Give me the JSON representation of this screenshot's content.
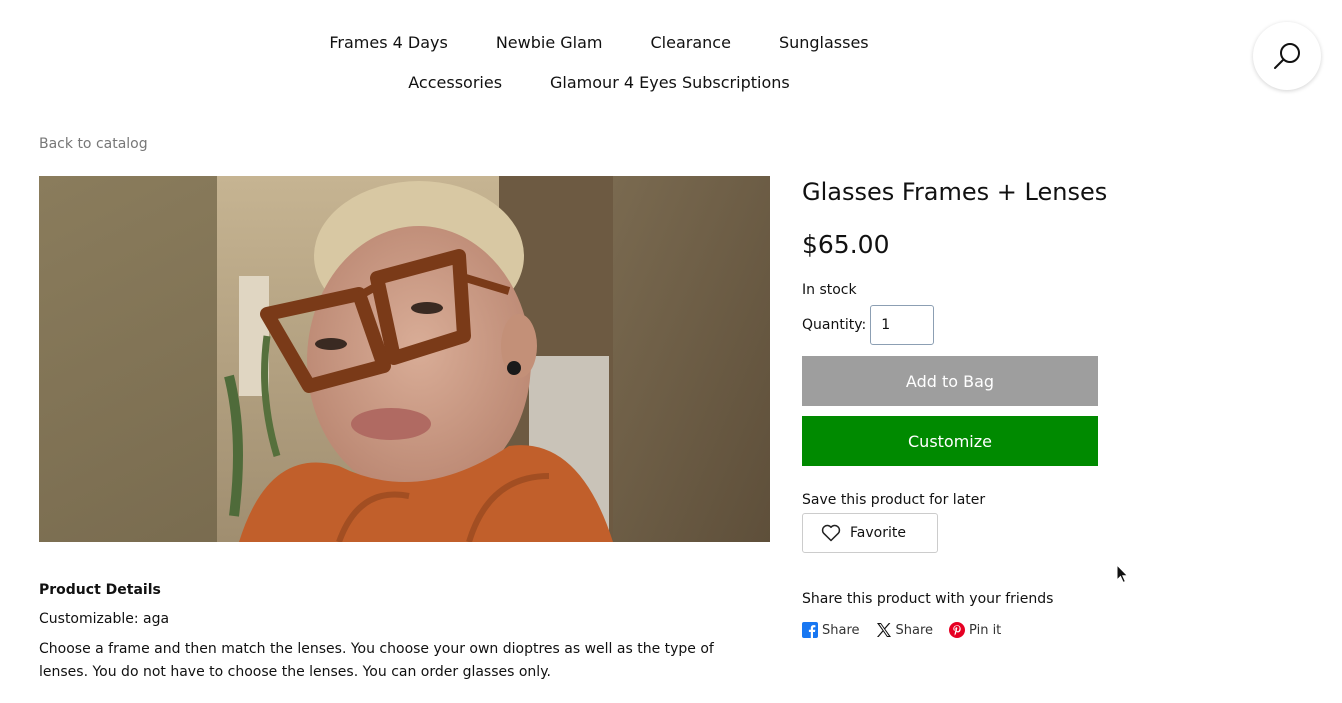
{
  "nav": {
    "row1": [
      "Frames 4 Days",
      "Newbie Glam",
      "Clearance",
      "Sunglasses"
    ],
    "row2": [
      "Accessories",
      "Glamour 4 Eyes Subscriptions"
    ]
  },
  "search": {
    "icon": "search-icon"
  },
  "back_link": "Back to catalog",
  "product": {
    "title": "Glasses Frames + Lenses",
    "price": "$65.00",
    "stock": "In stock",
    "quantity_label": "Quantity:",
    "quantity_value": "1",
    "add_to_bag": "Add to Bag",
    "customize": "Customize",
    "save_label": "Save this product for later",
    "favorite": "Favorite",
    "share_label": "Share this product with your friends",
    "share": {
      "facebook": "Share",
      "x": "Share",
      "pinterest": "Pin it"
    }
  },
  "details": {
    "heading": "Product Details",
    "customizable": "Customizable: aga",
    "description": "Choose a frame and then match the lenses. You choose your own dioptres as well as the type of lenses. You do not have to choose the lenses. You can order glasses only."
  },
  "colors": {
    "add_to_bag_bg": "#9e9e9e",
    "customize_bg": "#008a00",
    "facebook": "#1877f2",
    "pinterest": "#e60023"
  }
}
